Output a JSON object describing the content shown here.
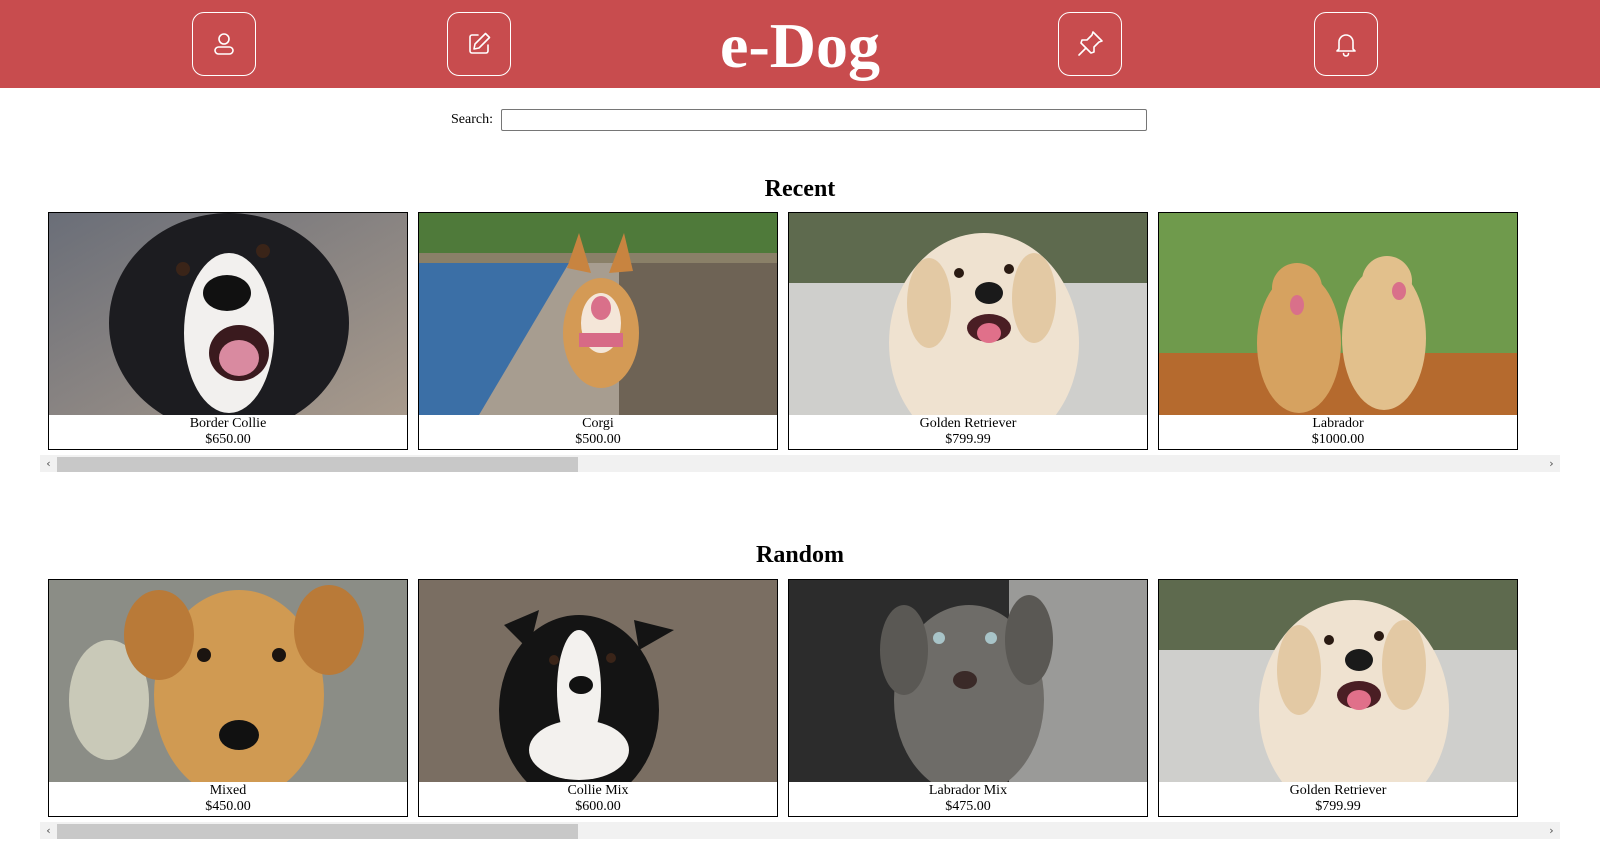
{
  "header": {
    "logo": "e-Dog",
    "buttons": [
      {
        "icon": "profile-icon"
      },
      {
        "icon": "edit-icon"
      },
      {
        "icon": "pin-icon"
      },
      {
        "icon": "bell-icon"
      }
    ],
    "color": "#c84c4e"
  },
  "search": {
    "label": "Search:",
    "value": "",
    "placeholder": ""
  },
  "sections": [
    {
      "title": "Recent",
      "cards": [
        {
          "name": "Border Collie",
          "price": "$650.00"
        },
        {
          "name": "Corgi",
          "price": "$500.00"
        },
        {
          "name": "Golden Retriever",
          "price": "$799.99"
        },
        {
          "name": "Labrador",
          "price": "$1000.00"
        }
      ]
    },
    {
      "title": "Random",
      "cards": [
        {
          "name": "Mixed",
          "price": "$450.00"
        },
        {
          "name": "Collie Mix",
          "price": "$600.00"
        },
        {
          "name": "Labrador Mix",
          "price": "$475.00"
        },
        {
          "name": "Golden Retriever",
          "price": "$799.99"
        }
      ]
    }
  ],
  "scrollbar": {
    "left_arrow": "‹",
    "right_arrow": "›"
  }
}
